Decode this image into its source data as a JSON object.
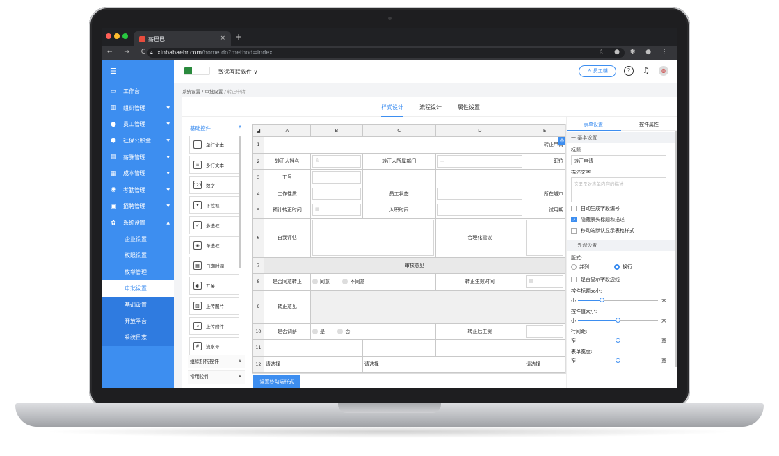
{
  "browser": {
    "tab_title": "薪巴巴",
    "tab_close": "×",
    "new_tab": "+",
    "url_host": "xinbabaehr.com",
    "url_path": "/home.do?method=index",
    "nav_glyphs": "← → C",
    "tool_glyphs": "☆ ● ✱ ● ⋮"
  },
  "sidebar": {
    "menu_icon": "☰",
    "items": [
      {
        "label": "工作台",
        "icon": "monitor-icon",
        "glyph": "▭",
        "arrow": ""
      },
      {
        "label": "组织管理",
        "icon": "org-icon",
        "glyph": "▥",
        "arrow": "▼"
      },
      {
        "label": "员工管理",
        "icon": "person-icon",
        "glyph": "●",
        "arrow": "▼"
      },
      {
        "label": "社保公积金",
        "icon": "shield-icon",
        "glyph": "⬢",
        "arrow": "▼"
      },
      {
        "label": "薪酬管理",
        "icon": "wallet-icon",
        "glyph": "▤",
        "arrow": "▼"
      },
      {
        "label": "成本管理",
        "icon": "grid-icon",
        "glyph": "▦",
        "arrow": "▼"
      },
      {
        "label": "考勤管理",
        "icon": "location-icon",
        "glyph": "◉",
        "arrow": "▼"
      },
      {
        "label": "招聘管理",
        "icon": "briefcase-icon",
        "glyph": "▣",
        "arrow": "▼"
      },
      {
        "label": "系统设置",
        "icon": "gear-icon",
        "glyph": "✿",
        "arrow": "▲"
      }
    ],
    "sub_items": [
      {
        "label": "企业设置",
        "state": "normal"
      },
      {
        "label": "权限设置",
        "state": "normal"
      },
      {
        "label": "枚举管理",
        "state": "normal"
      },
      {
        "label": "审批设置",
        "state": "active"
      },
      {
        "label": "基础设置",
        "state": "dark"
      },
      {
        "label": "开放平台",
        "state": "dark"
      },
      {
        "label": "系统日志",
        "state": "dark"
      }
    ]
  },
  "topbar": {
    "company": "致远互联软件 ∨",
    "employee_button": "♙ 员工端",
    "help_icon": "?",
    "bell_icon": "♫",
    "avatar": "◍"
  },
  "breadcrumb": {
    "a": "系统设置",
    "sep": "/",
    "b": "审批设置",
    "c": "转正申请"
  },
  "main_tabs": [
    "样式设计",
    "流程设计",
    "属性设置"
  ],
  "controls": {
    "basic_header": "基础控件",
    "up_arrow": "∧",
    "items": [
      {
        "label": "单行文本",
        "glyph": "—"
      },
      {
        "label": "多行文本",
        "glyph": "≡"
      },
      {
        "label": "数字",
        "glyph": "123"
      },
      {
        "label": "下拉框",
        "glyph": "▾"
      },
      {
        "label": "多选框",
        "glyph": "✓"
      },
      {
        "label": "单选框",
        "glyph": "◉"
      },
      {
        "label": "日期时间",
        "glyph": "▦"
      },
      {
        "label": "开关",
        "glyph": "◐"
      },
      {
        "label": "上传图片",
        "glyph": "▨"
      },
      {
        "label": "上传附件",
        "glyph": "∂"
      },
      {
        "label": "流水号",
        "glyph": "#"
      }
    ],
    "group_org": "组织机构控件",
    "group_common": "常用控件",
    "down_arrow": "∨"
  },
  "grid": {
    "columns": [
      "A",
      "B",
      "C",
      "D",
      "E"
    ],
    "rows": {
      "r1": {
        "n": "1",
        "e": "转正申请"
      },
      "r2": {
        "n": "2",
        "a": "转正人姓名",
        "c": "转正人所属部门",
        "e": "职位"
      },
      "r3": {
        "n": "3",
        "a": "工号"
      },
      "r4": {
        "n": "4",
        "a": "工作性质",
        "c": "员工状态",
        "e": "所在城市"
      },
      "r5": {
        "n": "5",
        "a": "预计转正时间",
        "c": "入职时间",
        "e": "试用期"
      },
      "r6": {
        "n": "6",
        "a": "自我评估",
        "d": "合理化建议"
      },
      "r7": {
        "n": "7",
        "merged": "审核意见"
      },
      "r8": {
        "n": "8",
        "a": "是否同意转正",
        "opt1": "同意",
        "opt2": "不同意",
        "d": "转正生效时间"
      },
      "r9": {
        "n": "9",
        "a": "转正意见"
      },
      "r10": {
        "n": "10",
        "a": "是否调薪",
        "opt1": "是",
        "opt2": "否",
        "d": "转正后工资"
      },
      "r11": {
        "n": "11"
      },
      "r12": {
        "n": "12",
        "b": "请选择",
        "c": "请选择",
        "e": "请选择"
      }
    },
    "gear": "⚙"
  },
  "mobile_button": "设置移动端样式",
  "right_panel": {
    "tabs": [
      "表单设置",
      "控件属性"
    ],
    "section_basic": "一 基本设置",
    "title_label": "标题",
    "title_value": "转正申请",
    "desc_label": "描述文字",
    "desc_placeholder": "这里是对表单内容的描述",
    "checks": [
      {
        "label": "自动生成字段编号",
        "on": false
      },
      {
        "label": "隐藏表头标题和描述",
        "on": true
      },
      {
        "label": "移动端默认显示表格样式",
        "on": false
      }
    ],
    "section_look": "一 外观设置",
    "layout_label": "版式:",
    "layout_opt1": "并列",
    "layout_opt2": "换行",
    "border_check": "是否显示字段边线",
    "sliders": [
      {
        "label": "控件标题大小:",
        "left": "小",
        "right": "大",
        "value": 0.3
      },
      {
        "label": "控件值大小:",
        "left": "小",
        "right": "大",
        "value": 0.5
      },
      {
        "label": "行间距:",
        "left": "窄",
        "right": "宽",
        "value": 0.5
      },
      {
        "label": "表单宽度:",
        "left": "窄",
        "right": "宽",
        "value": 0.5
      }
    ]
  }
}
